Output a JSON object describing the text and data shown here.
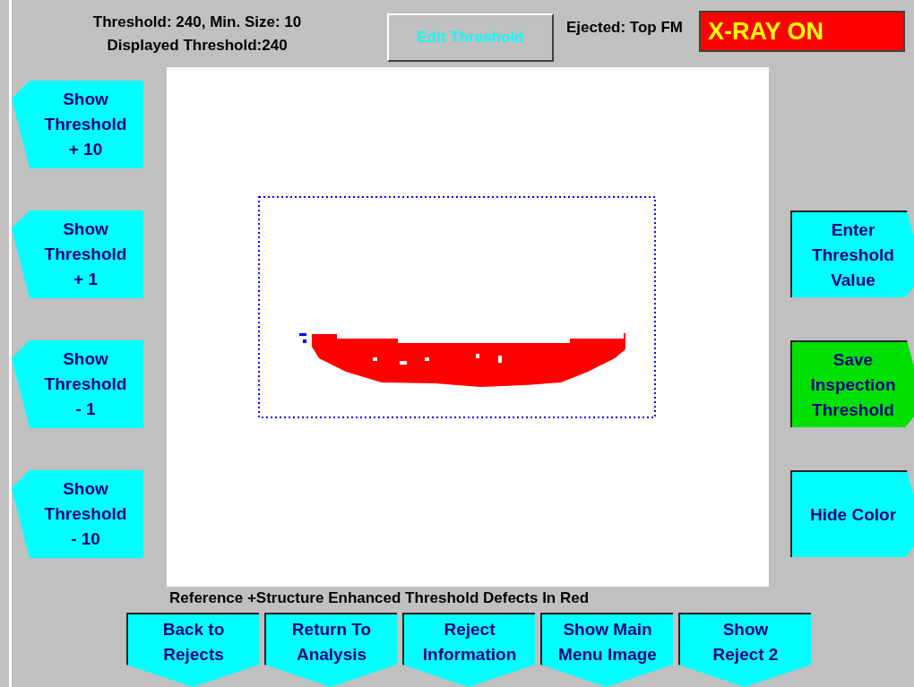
{
  "header": {
    "threshold_line": "Threshold: 240, Min. Size: 10",
    "displayed_line": "Displayed Threshold:240",
    "edit_button": "Edit Threshold",
    "ejected": "Ejected: Top FM",
    "xray_status": "X-RAY ON"
  },
  "left_buttons": [
    {
      "label": "Show\nThreshold\n+ 10"
    },
    {
      "label": "Show\nThreshold\n+ 1"
    },
    {
      "label": "Show\nThreshold\n- 1"
    },
    {
      "label": "Show\nThreshold\n- 10"
    }
  ],
  "right_buttons": [
    {
      "label": "Enter\nThreshold\nValue",
      "color": "#00ffff"
    },
    {
      "label": "Save\nInspection\nThreshold",
      "color": "#00e000"
    },
    {
      "label": "Hide Color",
      "color": "#00ffff"
    }
  ],
  "caption": "Reference +Structure Enhanced Threshold Defects In Red",
  "bottom_buttons": [
    {
      "label": "Back to\nRejects"
    },
    {
      "label": "Return To\nAnalysis"
    },
    {
      "label": "Reject\nInformation"
    },
    {
      "label": "Show Main\nMenu Image"
    },
    {
      "label": "Show\nReject 2"
    }
  ]
}
